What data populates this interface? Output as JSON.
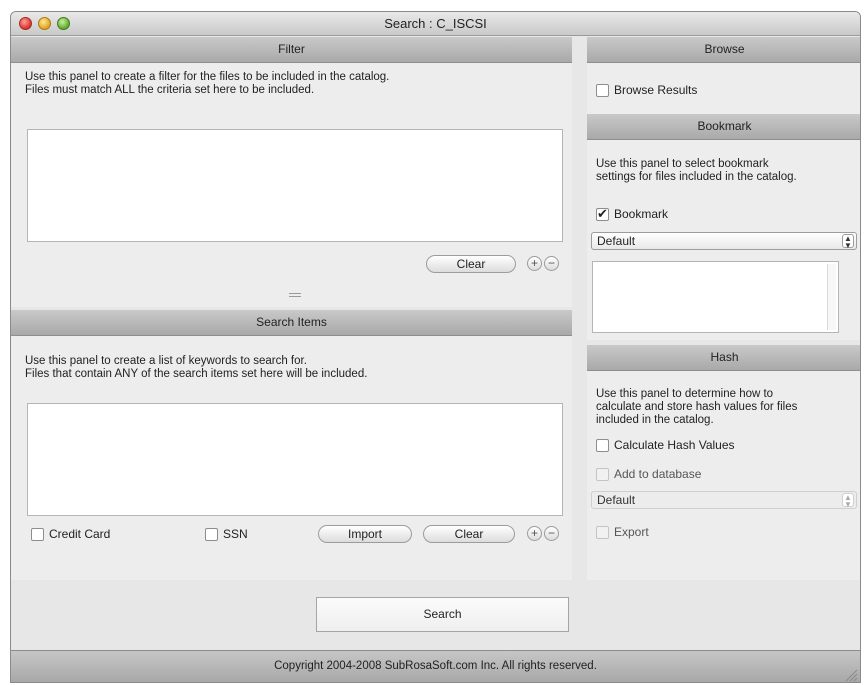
{
  "window": {
    "title": "Search : C_ISCSI"
  },
  "filter": {
    "header": "Filter",
    "description_line1": "Use this panel to create a filter for the files to be included in the catalog.",
    "description_line2": "Files must match ALL the criteria set here to be included.",
    "clear_label": "Clear",
    "add_label": "+",
    "remove_label": "−"
  },
  "search_items": {
    "header": "Search Items",
    "description_line1": "Use this panel to create a list of keywords to search for.",
    "description_line2": "Files that contain ANY of the search items set here will be included.",
    "credit_card_label": "Credit Card",
    "credit_card_checked": false,
    "ssn_label": "SSN",
    "ssn_checked": false,
    "import_label": "Import",
    "clear_label": "Clear",
    "add_label": "+",
    "remove_label": "−"
  },
  "browse": {
    "header": "Browse",
    "browse_results_label": "Browse Results",
    "browse_results_checked": false
  },
  "bookmark": {
    "header": "Bookmark",
    "description_line1": "Use this panel to select bookmark",
    "description_line2": "settings for files included in the catalog.",
    "bookmark_label": "Bookmark",
    "bookmark_checked": true,
    "select_value": "Default"
  },
  "hash": {
    "header": "Hash",
    "description_line1": "Use this panel to determine how to",
    "description_line2": "calculate and store hash values for files",
    "description_line3": "included in the catalog.",
    "calculate_label": "Calculate Hash Values",
    "calculate_checked": false,
    "add_db_label": "Add to database",
    "add_db_checked": false,
    "select_value": "Default",
    "export_label": "Export",
    "export_checked": false
  },
  "search_button_label": "Search",
  "footer_text": "Copyright 2004-2008 SubRosaSoft.com Inc. All rights reserved."
}
